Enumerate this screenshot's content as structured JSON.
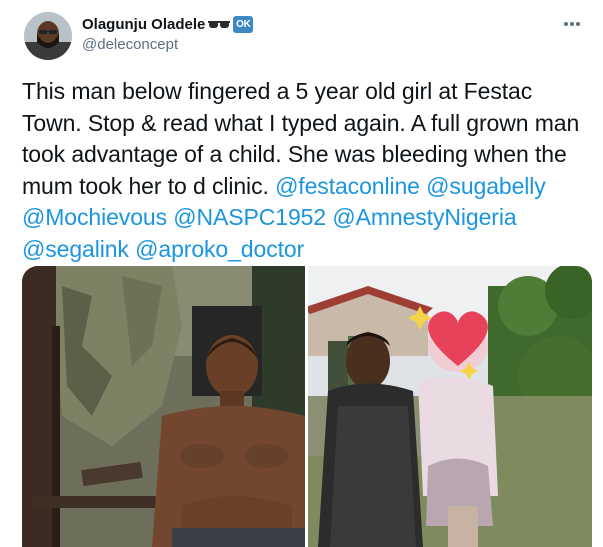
{
  "user": {
    "display_name": "Olagunju Oladele",
    "emoji": "sunglasses-emoji",
    "badge": "OK",
    "handle": "@deleconcept",
    "avatar": "avatar-photo"
  },
  "tweet": {
    "text_part1": "This man below fingered a 5 year old girl at Festac Town. Stop & read what I typed again. A full grown man took advantage of a child. She was bleeding when the mum took her to d clinic. ",
    "mentions": [
      "@festaconline",
      "@sugabelly",
      "@Mochievous",
      "@NASPC1952",
      "@AmnestyNigeria",
      "@segalink",
      "@aproko_doctor"
    ]
  },
  "media": {
    "photos": [
      "photo-shirtless-man",
      "photo-woman-with-child"
    ],
    "overlay_icons": [
      "heart-emoji",
      "sparkles-emoji"
    ]
  },
  "colors": {
    "link": "#1b95e0",
    "secondary_text": "#5b7083",
    "badge": "#3b88c3",
    "heart": "#e8415a"
  },
  "icons": {
    "more": "more-options-icon"
  }
}
